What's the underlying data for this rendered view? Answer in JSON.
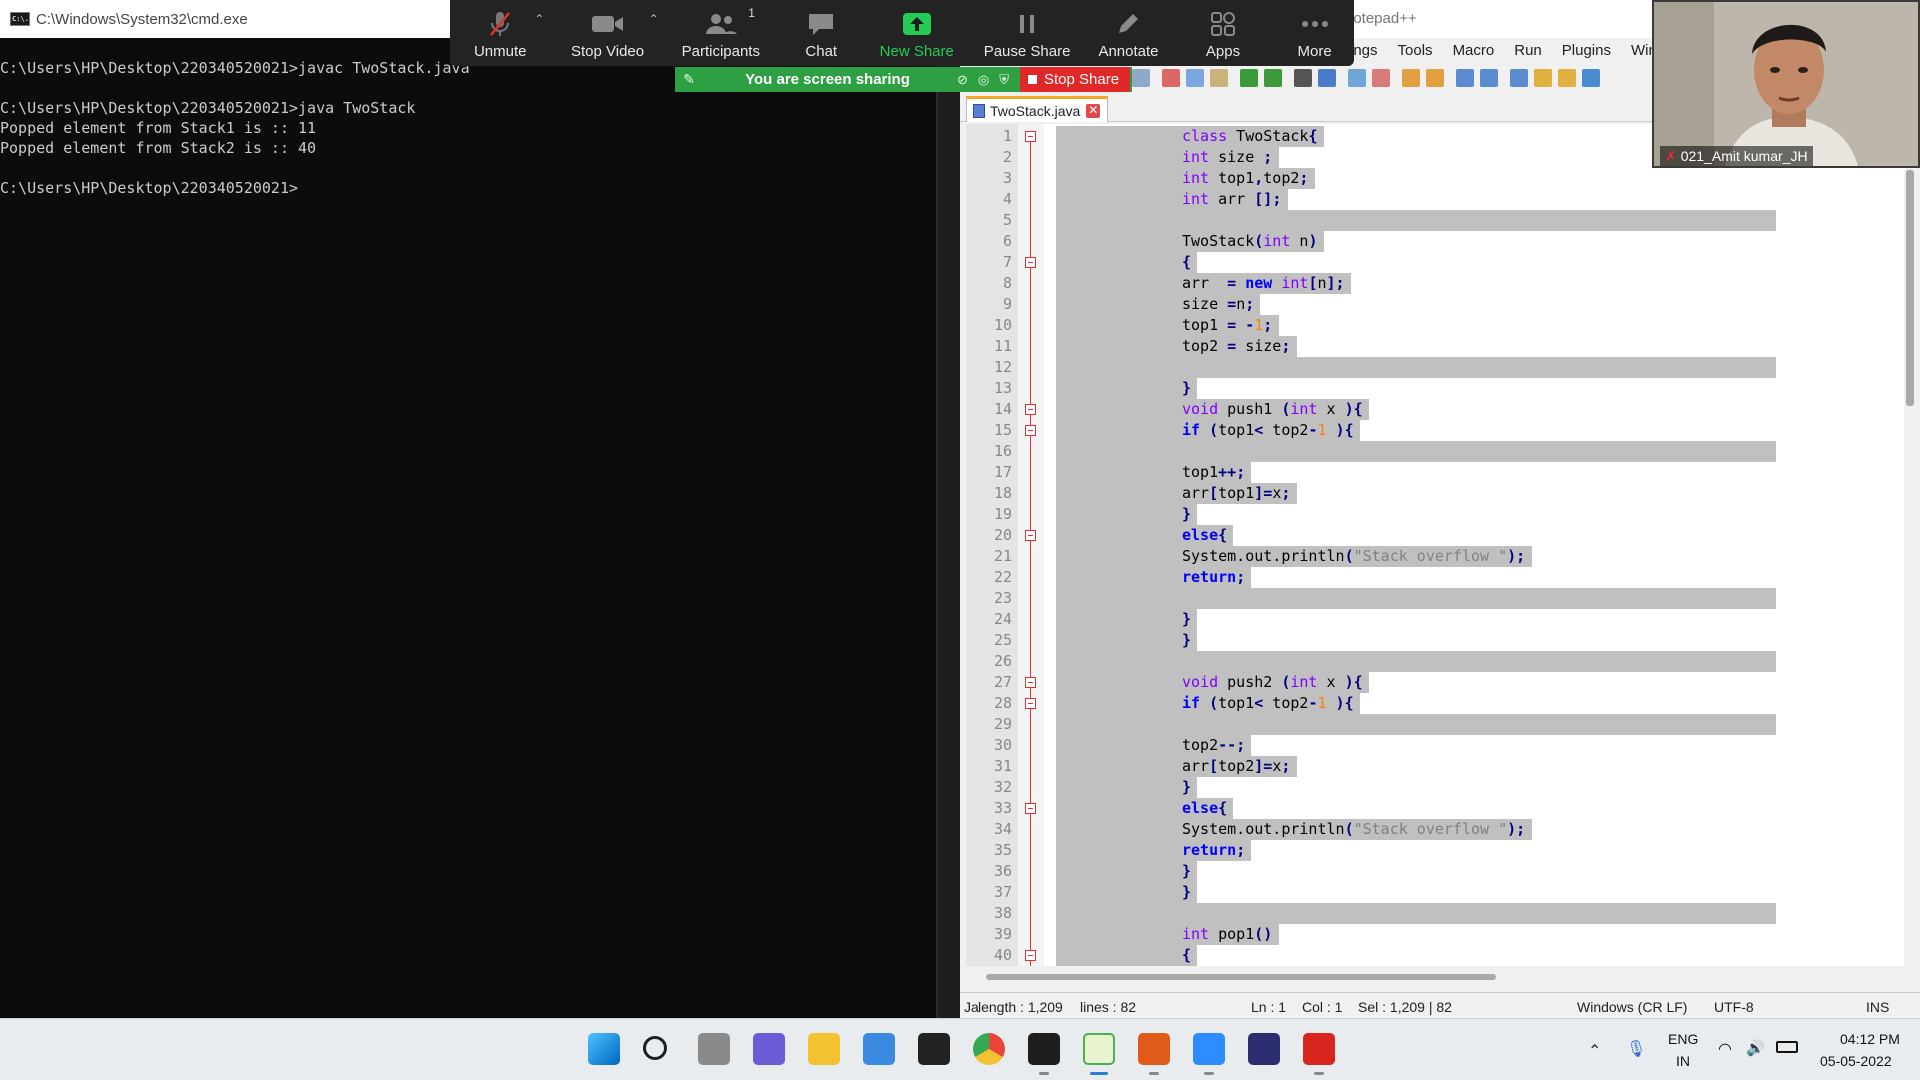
{
  "cmd": {
    "title": "C:\\Windows\\System32\\cmd.exe",
    "icon_text": "C:\\.",
    "lines": [
      "C:\\Users\\HP\\Desktop\\220340520021>javac TwoStack.java",
      "",
      "C:\\Users\\HP\\Desktop\\220340520021>java TwoStack",
      "Popped element from Stack1 is :: 11",
      "Popped element from Stack2 is :: 40",
      "",
      "C:\\Users\\HP\\Desktop\\220340520021>"
    ]
  },
  "zoom": {
    "buttons": [
      {
        "label": "Unmute",
        "icon": "microphone-muted-icon"
      },
      {
        "label": "Stop Video",
        "icon": "video-camera-icon"
      },
      {
        "label": "Participants",
        "icon": "participants-icon",
        "count": "1"
      },
      {
        "label": "Chat",
        "icon": "chat-icon"
      },
      {
        "label": "New Share",
        "icon": "share-up-arrow-icon"
      },
      {
        "label": "Pause Share",
        "icon": "pause-icon"
      },
      {
        "label": "Annotate",
        "icon": "pencil-icon"
      },
      {
        "label": "Apps",
        "icon": "apps-icon"
      },
      {
        "label": "More",
        "icon": "more-dots-icon"
      }
    ],
    "sharing_text": "You are screen sharing",
    "stop_share": "Stop Share",
    "accent_green": "#22cc55",
    "stop_red": "#e02828"
  },
  "npp": {
    "title": "Notepad++",
    "title_visible": "lotepad++",
    "menu": [
      "ings",
      "Tools",
      "Macro",
      "Run",
      "Plugins",
      "Wind"
    ],
    "tab": "TwoStack.java",
    "status": {
      "length": "length : 1,209",
      "lines": "lines : 82",
      "ln": "Ln : 1",
      "col": "Col : 1",
      "sel": "Sel : 1,209 | 82",
      "eol": "Windows (CR LF)",
      "enc": "UTF-8",
      "mode": "INS",
      "lang_prefix": "Ja"
    }
  },
  "code_lines": [
    "class TwoStack{",
    "int size ;",
    "int top1,top2;",
    "int arr [];",
    "",
    "TwoStack(int n)",
    "{",
    "arr  = new int[n];",
    "size =n;",
    "top1 = -1;",
    "top2 = size;",
    "",
    "}",
    "void push1 (int x ){",
    "if (top1< top2-1 ){",
    "",
    "top1++;",
    "arr[top1]=x;",
    "}",
    "else{",
    "System.out.println(\"Stack overflow \");",
    "return;",
    "",
    "}",
    "}",
    "",
    "void push2 (int x ){",
    "if (top1< top2-1 ){",
    "",
    "top2--;",
    "arr[top2]=x;",
    "}",
    "else{",
    "System.out.println(\"Stack overflow \");",
    "return;",
    "}",
    "}",
    "",
    "int pop1()",
    "{"
  ],
  "line_numbers": [
    "1",
    "2",
    "3",
    "4",
    "5",
    "6",
    "7",
    "8",
    "9",
    "10",
    "11",
    "12",
    "13",
    "14",
    "15",
    "16",
    "17",
    "18",
    "19",
    "20",
    "21",
    "22",
    "23",
    "24",
    "25",
    "26",
    "27",
    "28",
    "29",
    "30",
    "31",
    "32",
    "33",
    "34",
    "35",
    "36",
    "37",
    "38",
    "39",
    "40"
  ],
  "fold_lines": [
    1,
    7,
    14,
    15,
    20,
    27,
    28,
    33,
    40
  ],
  "webcam": {
    "name": "021_Amit kumar_JH"
  },
  "taskbar": {
    "apps": [
      "windows-start-icon",
      "search-icon",
      "task-view-icon",
      "teams-chat-icon",
      "file-explorer-icon",
      "microsoft-store-icon",
      "github-icon",
      "chrome-icon",
      "terminal-icon",
      "notepadpp-icon",
      "app-2004-icon",
      "zoom-icon",
      "eclipse-icon",
      "acrobat-icon"
    ],
    "lang_top": "ENG",
    "lang_bottom": "IN",
    "time": "04:12 PM",
    "date": "05-05-2022"
  }
}
